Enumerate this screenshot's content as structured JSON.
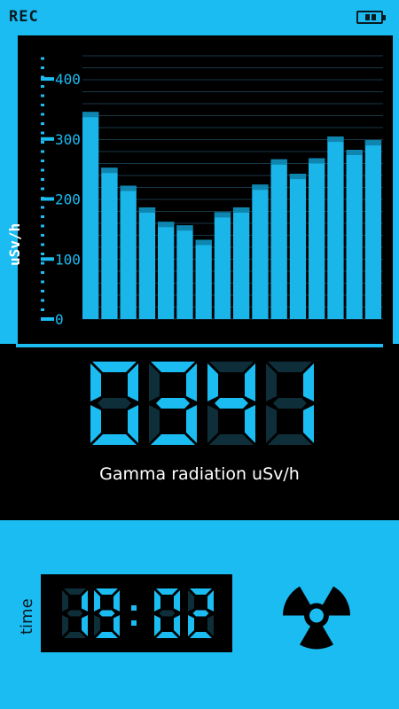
{
  "status_bar": {
    "rec_label": "REC",
    "battery_icon": "battery-icon"
  },
  "reading": {
    "digits": "0341",
    "caption": "Gamma radiation uSv/h"
  },
  "time_panel": {
    "label": "time",
    "clock": "19:02"
  },
  "icons": {
    "hazard": "radiation-hazard-icon"
  },
  "colors": {
    "accent": "#1bbcf2",
    "dark": "#0a1a22",
    "segment_off": "#0e2e3a"
  },
  "chart_data": {
    "type": "bar",
    "ylabel": "uSv/h",
    "yticks": [
      0,
      100,
      200,
      300,
      400
    ],
    "ylim": [
      0,
      440
    ],
    "values": [
      345,
      252,
      222,
      186,
      162,
      156,
      132,
      178,
      186,
      224,
      266,
      242,
      268,
      304,
      282,
      298
    ]
  }
}
